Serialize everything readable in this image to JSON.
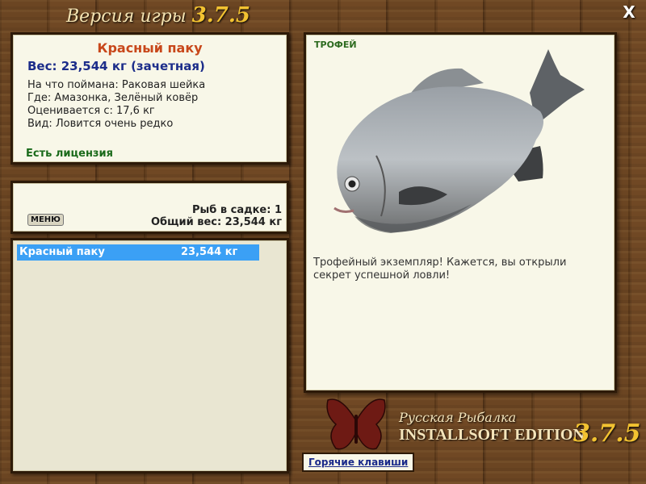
{
  "window": {
    "title_prefix": "Версия игры",
    "title_version": "3.7.5",
    "close_label": "X"
  },
  "fish_card": {
    "name": "Красный паку",
    "weight": "Вес: 23,544 кг (зачетная)",
    "caught_on": "На что поймана: Раковая шейка",
    "location": "Где: Амазонка, Зелёный ковёр",
    "rated_from": "Оценивается с: 17,6 кг",
    "rarity": "Вид: Ловится очень редко",
    "license": "Есть лицензия"
  },
  "keepnet": {
    "menu_label": "МЕНЮ",
    "fish_count": "Рыб в садке: 1",
    "total_weight": "Общий вес: 23,544 кг"
  },
  "catch_list": [
    {
      "name": "Красный паку",
      "weight": "23,544 кг"
    }
  ],
  "trophy_panel": {
    "badge": "ТРОФЕЙ",
    "description": "Трофейный экземпляр! Кажется, вы открыли секрет успешной ловли!"
  },
  "branding": {
    "game_name": "Русская Рыбалка",
    "edition": "INSTALLSOFT EDITION",
    "version": "3.7.5",
    "logo_icon": "butterfly-icon"
  },
  "hotkeys_label": "Горячие клавиши",
  "colors": {
    "fish_name": "#c8471a",
    "weight": "#1c2d8a",
    "license": "#1a6a1a",
    "selection": "#3ba0f5",
    "version_gold": "#f2c231"
  }
}
